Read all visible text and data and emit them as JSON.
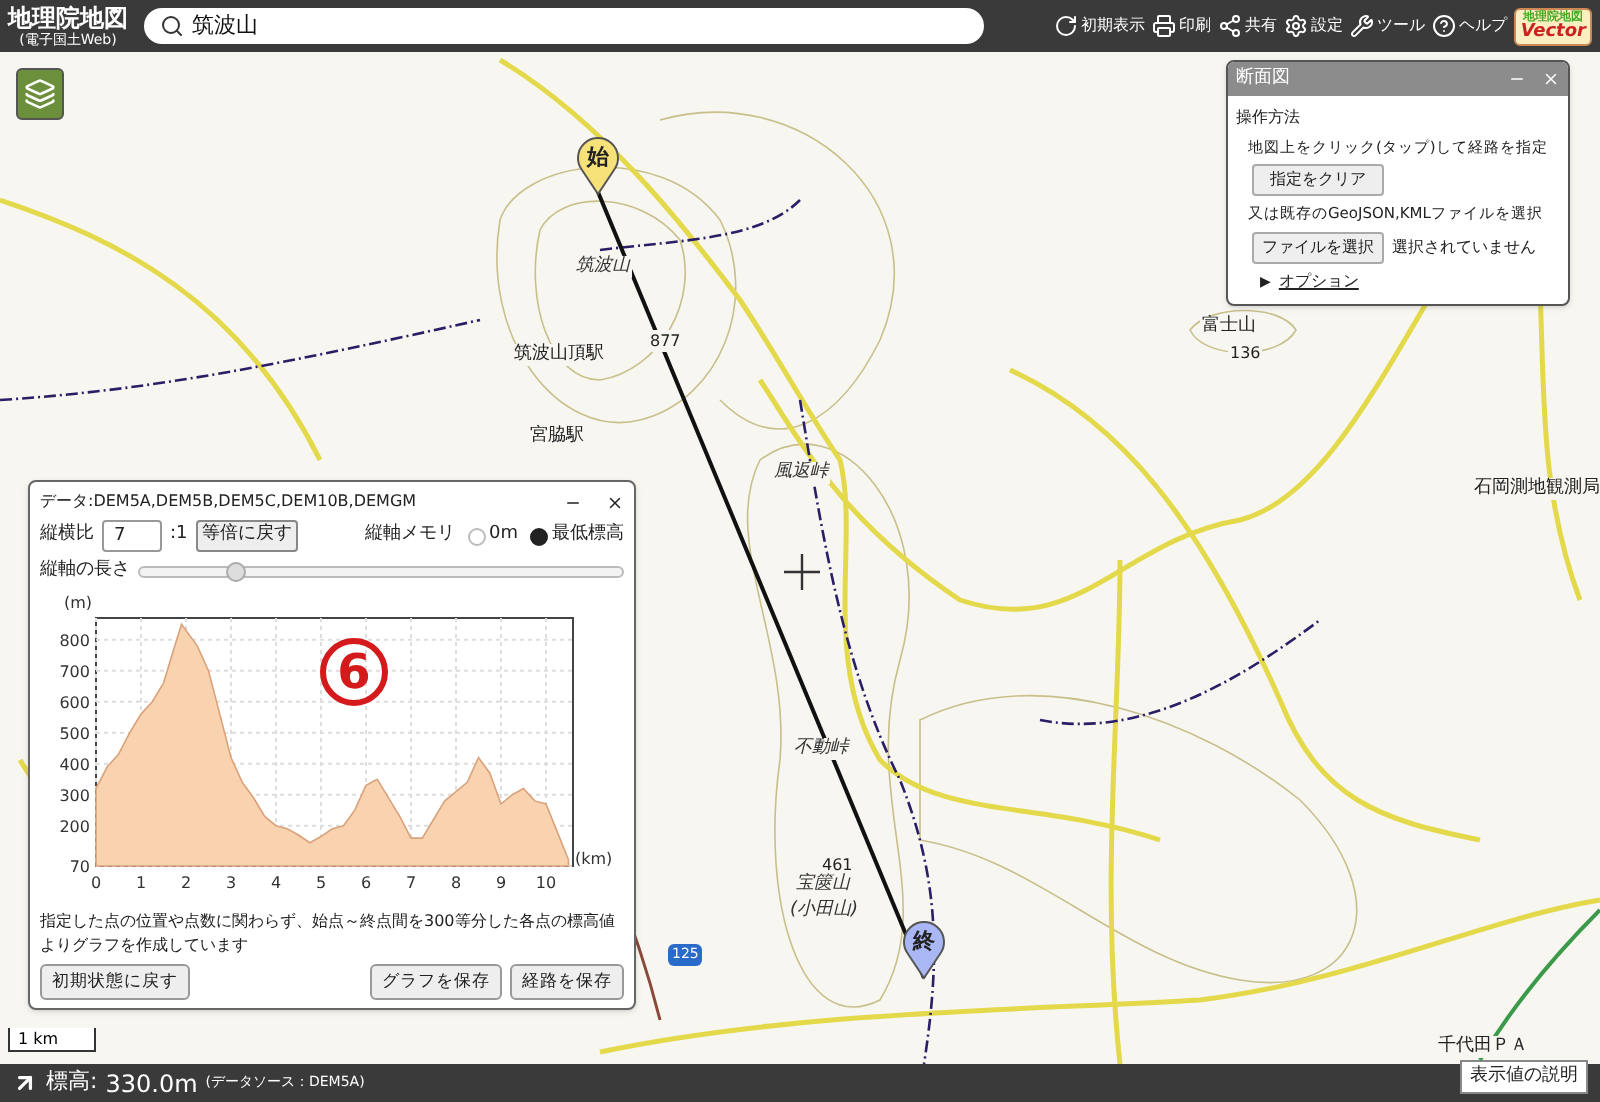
{
  "header": {
    "logo_title": "地理院地図",
    "logo_subtitle": "(電子国土Web)",
    "search": {
      "value": "筑波山"
    },
    "buttons": [
      {
        "label": "初期表示",
        "kind": "reset"
      },
      {
        "label": "印刷",
        "kind": "print"
      },
      {
        "label": "共有",
        "kind": "share"
      },
      {
        "label": "設定",
        "kind": "settings"
      },
      {
        "label": "ツール",
        "kind": "tools"
      },
      {
        "label": "ヘルプ",
        "kind": "help"
      }
    ],
    "vector_logo": {
      "line1": "地理院地図",
      "line2": "Vector"
    }
  },
  "profile_panel": {
    "title": "断面図",
    "heading": "操作方法",
    "instruction": "地図上をクリック(タップ)して経路を指定",
    "clear_button": "指定をクリア",
    "file_instruction": "又は既存のGeoJSON,KMLファイルを選択",
    "file_button": "ファイルを選択",
    "file_status": "選択されていません",
    "options_link": {
      "icon": "▶",
      "label": "オプション"
    }
  },
  "chart_panel": {
    "title": "データ:DEM5A,DEM5B,DEM5C,DEM10B,DEMGM",
    "ratio_label": "縦横比",
    "ratio_value": "7",
    "ratio_suffix": ":1",
    "ratio_reset": "等倍に戻す",
    "axis_memory": {
      "label": "縦軸メモリ",
      "options": [
        {
          "label": "0m",
          "selected": false
        },
        {
          "label": "最低標高",
          "selected": true
        }
      ]
    },
    "axis_length": {
      "label": "縦軸の長さ",
      "level": 0.2
    },
    "annotation": "6",
    "chart_data": {
      "type": "area",
      "xlabel": "(km)",
      "ylabel": "(m)",
      "grid": true,
      "x": [
        0,
        0.25,
        0.5,
        0.75,
        1,
        1.25,
        1.5,
        1.75,
        1.9,
        2,
        2.25,
        2.5,
        2.75,
        3,
        3.25,
        3.5,
        3.75,
        4,
        4.25,
        4.5,
        4.75,
        5,
        5.25,
        5.5,
        5.75,
        6,
        6.25,
        6.5,
        6.75,
        7,
        7.25,
        7.5,
        7.75,
        8,
        8.25,
        8.5,
        8.75,
        9,
        9.25,
        9.5,
        9.75,
        10,
        10.25,
        10.5
      ],
      "series": [
        {
          "color": "#f9d2b0",
          "values": [
            320,
            390,
            430,
            500,
            560,
            600,
            660,
            780,
            850,
            830,
            780,
            700,
            560,
            420,
            340,
            290,
            230,
            200,
            190,
            170,
            145,
            165,
            190,
            200,
            250,
            330,
            350,
            290,
            230,
            160,
            160,
            220,
            280,
            310,
            340,
            420,
            370,
            270,
            300,
            320,
            280,
            270,
            180,
            90
          ]
        }
      ],
      "xlim": [
        0,
        10.6
      ],
      "ylim": [
        70,
        870
      ],
      "xticks": [
        0,
        1,
        2,
        3,
        4,
        5,
        6,
        7,
        8,
        9,
        10
      ],
      "yticks": [
        70,
        200,
        300,
        400,
        500,
        600,
        700,
        800
      ]
    },
    "note": "指定した点の位置や点数に関わらず、始点～終点間を300等分した各点の標高値よりグラフを作成しています",
    "buttons": [
      "初期状態に戻す",
      "グラフを保存",
      "経路を保存"
    ]
  },
  "map": {
    "labels": [
      {
        "text": "筑波山",
        "kind": "peak"
      },
      {
        "text": "877",
        "kind": "elevation"
      },
      {
        "text": "筑波山頂駅",
        "kind": "station"
      },
      {
        "text": "宮脇駅",
        "kind": "station"
      },
      {
        "text": "風返峠",
        "kind": "peak"
      },
      {
        "text": "富士山",
        "kind": "place"
      },
      {
        "text": "136",
        "kind": "elevation"
      },
      {
        "text": "石岡測地観測局",
        "kind": "place"
      },
      {
        "text": "不動峠",
        "kind": "peak"
      },
      {
        "text": "461",
        "kind": "elevation"
      },
      {
        "text": "宝篋山",
        "kind": "peak"
      },
      {
        "text": "(小田山)",
        "kind": "peak"
      },
      {
        "text": "千代田ＰＡ",
        "kind": "place"
      }
    ],
    "markers": [
      {
        "label": "始",
        "kind": "start"
      },
      {
        "label": "終",
        "kind": "end"
      }
    ],
    "route_shield": "125",
    "scale": "1 km"
  },
  "status_bar": {
    "elevation_label": "標高:",
    "elevation": "330.0m",
    "source": "(データソース：DEM5A)",
    "help_button": "表示値の説明"
  }
}
